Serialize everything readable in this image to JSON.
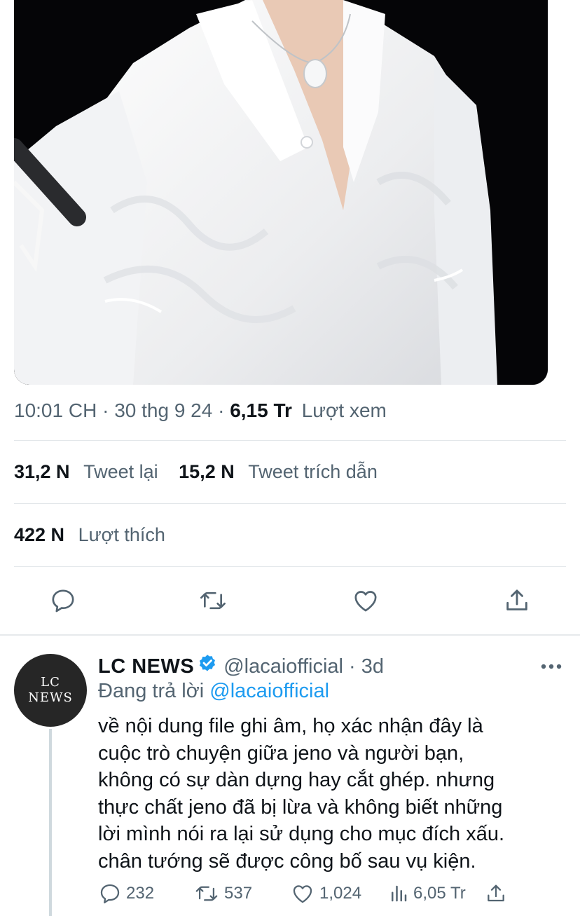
{
  "tweet": {
    "timestamp": "10:01 CH",
    "separator": "·",
    "date": "30 thg 9 24",
    "views_count": "6,15 Tr",
    "views_label": "Lượt xem",
    "retweets_count": "31,2 N",
    "retweets_label": "Tweet lại",
    "quotes_count": "15,2 N",
    "quotes_label": "Tweet trích dẫn",
    "likes_count": "422 N",
    "likes_label": "Lượt thích",
    "actions": [
      "reply-icon",
      "retweet-icon",
      "like-icon",
      "share-icon"
    ]
  },
  "reply": {
    "avatar_line1": "LC",
    "avatar_line2": "NEWS",
    "display_name": "LC NEWS",
    "handle": "@lacaiofficial",
    "age": "· 3d",
    "replying_prefix": "Đang trả lời",
    "replying_to": "@lacaiofficial",
    "text_lines": [
      "về nội dung file ghi âm, họ xác nhận đây là",
      "cuộc trò chuyện giữa jeno và người bạn,",
      "không có sự dàn dựng hay cắt ghép. nhưng",
      "thực chất jeno đã bị lừa và không biết những",
      "lời mình nói ra lại sử dụng cho mục đích xấu.",
      "chân tướng sẽ được công bố sau vụ kiện."
    ],
    "reply_count": "232",
    "retweet_count": "537",
    "like_count": "1,024",
    "view_count": "6,05 Tr"
  },
  "colors": {
    "accent": "#1d9bf0",
    "secondary_text": "#536471",
    "primary_text": "#0f1419",
    "divider": "#e3e7ea"
  }
}
